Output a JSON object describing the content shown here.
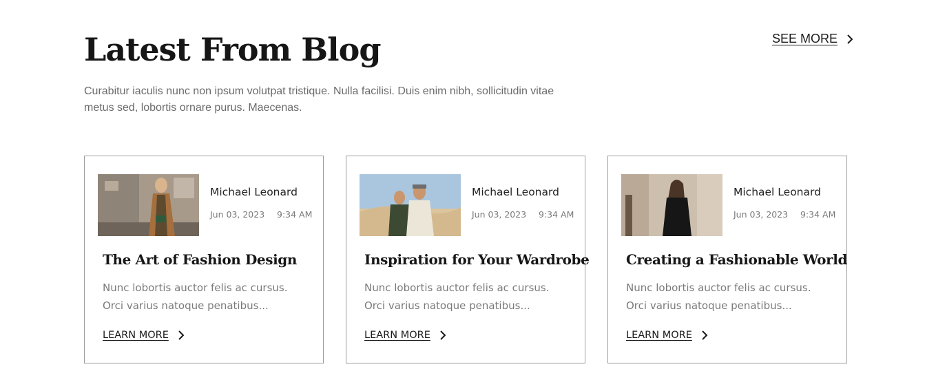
{
  "header": {
    "title": "Latest From Blog",
    "see_more": "SEE MORE",
    "intro": "Curabitur iaculis nunc non ipsum volutpat tristique. Nulla facilisi. Duis enim nibh, sollicitudin vitae metus sed, lobortis ornare purus. Maecenas."
  },
  "posts": [
    {
      "author": "Michael Leonard",
      "date": "Jun 03, 2023",
      "time": "9:34 AM",
      "title": "The Art of Fashion Design",
      "excerpt": "Nunc lobortis auctor felis ac cursus. Orci varius natoque penatibus...",
      "cta": "LEARN MORE",
      "thumb_icon": "woman-trench-coat-photo"
    },
    {
      "author": "Michael Leonard",
      "date": "Jun 03, 2023",
      "time": "9:34 AM",
      "title": "Inspiration for Your Wardrobe",
      "excerpt": "Nunc lobortis auctor felis ac cursus. Orci varius natoque penatibus...",
      "cta": "LEARN MORE",
      "thumb_icon": "couple-desert-photo"
    },
    {
      "author": "Michael Leonard",
      "date": "Jun 03, 2023",
      "time": "9:34 AM",
      "title": "Creating a Fashionable World",
      "excerpt": "Nunc lobortis auctor felis ac cursus. Orci varius natoque penatibus...",
      "cta": "LEARN MORE",
      "thumb_icon": "woman-black-outfit-photo"
    }
  ],
  "colors": {
    "text_dark": "#161616",
    "text_muted": "#7a7a7a",
    "card_border": "#9b9b9b"
  }
}
